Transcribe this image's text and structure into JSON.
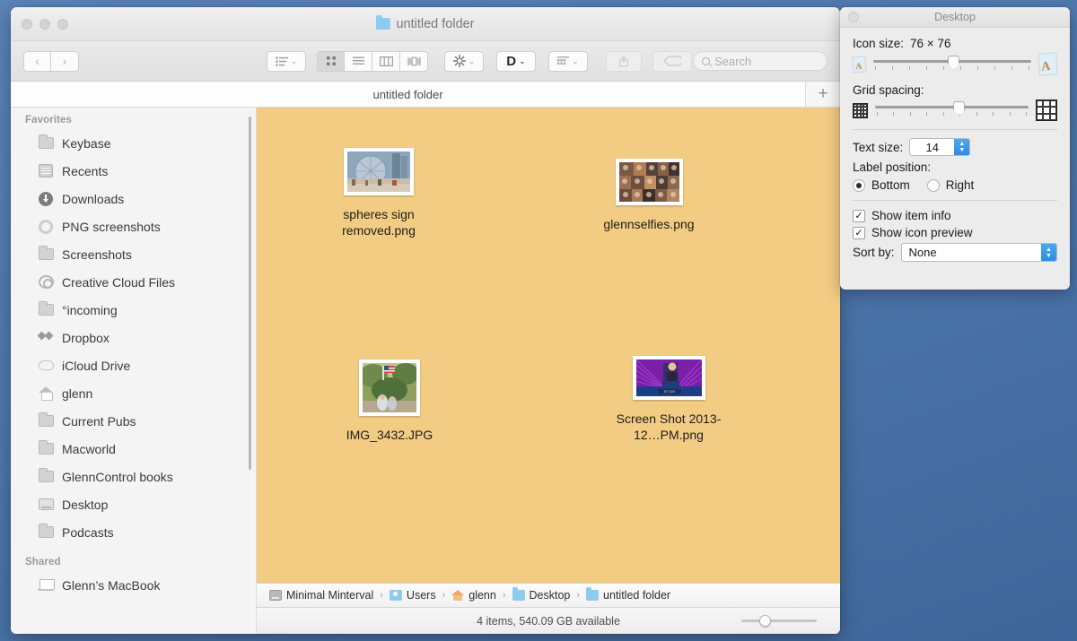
{
  "window": {
    "title": "untitled folder",
    "title_icon": "folder-icon",
    "traffic_lights": [
      "close",
      "minimize",
      "zoom"
    ]
  },
  "toolbar": {
    "back_label": "‹",
    "forward_label": "›",
    "arrange_label": "arrange-icon",
    "view_icon_label": "icon-view-icon",
    "view_list_label": "list-view-icon",
    "view_column_label": "column-view-icon",
    "view_coverflow_label": "coverflow-view-icon",
    "action_label": "gear-icon",
    "dropbox_label": "D",
    "group_label": "group-icon",
    "share_label": "share-icon",
    "tag_label": "tag-icon",
    "chevron": "⌄"
  },
  "search": {
    "placeholder": "Search",
    "value": "",
    "icon": "search-icon"
  },
  "tabbar": {
    "active_tab": "untitled folder",
    "add_label": "+"
  },
  "sidebar": {
    "sections": [
      {
        "title": "Favorites",
        "items": [
          {
            "label": "Keybase",
            "icon": "folder-icon"
          },
          {
            "label": "Recents",
            "icon": "recents-icon"
          },
          {
            "label": "Downloads",
            "icon": "download-icon"
          },
          {
            "label": "PNG screenshots",
            "icon": "gear-icon"
          },
          {
            "label": "Screenshots",
            "icon": "folder-icon"
          },
          {
            "label": "Creative Cloud Files",
            "icon": "creative-cloud-icon"
          },
          {
            "label": "°incoming",
            "icon": "folder-icon"
          },
          {
            "label": "Dropbox",
            "icon": "dropbox-icon"
          },
          {
            "label": "iCloud Drive",
            "icon": "icloud-icon"
          },
          {
            "label": "glenn",
            "icon": "home-icon"
          },
          {
            "label": "Current Pubs",
            "icon": "folder-icon"
          },
          {
            "label": "Macworld",
            "icon": "folder-icon"
          },
          {
            "label": "GlennControl books",
            "icon": "folder-icon"
          },
          {
            "label": "Desktop",
            "icon": "display-icon"
          },
          {
            "label": "Podcasts",
            "icon": "folder-icon"
          }
        ]
      },
      {
        "title": "Shared",
        "items": [
          {
            "label": "Glenn’s MacBook",
            "icon": "laptop-icon"
          }
        ]
      }
    ]
  },
  "files": {
    "background_color": "#f2cc83",
    "items": [
      {
        "name": "spheres sign removed.png",
        "thumb": "photo-spheres"
      },
      {
        "name": "glennselfies.png",
        "thumb": "photo-collage"
      },
      {
        "name": "IMG_3432.JPG",
        "thumb": "photo-outdoor"
      },
      {
        "name": "Screen Shot 2013-12…PM.png",
        "thumb": "photo-presentation"
      }
    ]
  },
  "pathbar": {
    "crumbs": [
      {
        "label": "Minimal Minterval",
        "icon": "disk-icon"
      },
      {
        "label": "Users",
        "icon": "users-folder-icon"
      },
      {
        "label": "glenn",
        "icon": "home-icon"
      },
      {
        "label": "Desktop",
        "icon": "folder-icon"
      },
      {
        "label": "untitled folder",
        "icon": "folder-icon"
      }
    ],
    "separator": "›"
  },
  "statusbar": {
    "text": "4 items, 540.09 GB available",
    "zoom_slider": "icon-size-slider"
  },
  "view_options": {
    "title": "Desktop",
    "icon_size": {
      "label": "Icon size:",
      "value": "76 × 76"
    },
    "grid_spacing": {
      "label": "Grid spacing:"
    },
    "text_size": {
      "label": "Text size:",
      "value": "14"
    },
    "label_position": {
      "label": "Label position:",
      "options": [
        "Bottom",
        "Right"
      ],
      "selected": "Bottom"
    },
    "show_item_info": {
      "label": "Show item info",
      "checked": true,
      "mark": "✓"
    },
    "show_icon_preview": {
      "label": "Show icon preview",
      "checked": true,
      "mark": "✓"
    },
    "sort_by": {
      "label": "Sort by:",
      "value": "None"
    },
    "stepper_up": "▲",
    "stepper_down": "▼"
  }
}
